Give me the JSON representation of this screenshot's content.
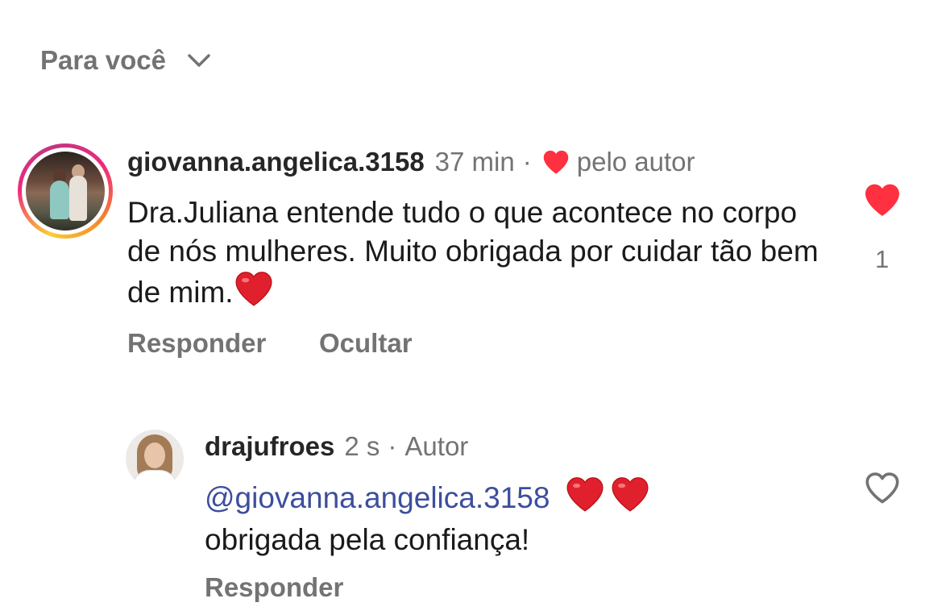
{
  "sort": {
    "label": "Para você"
  },
  "comment1": {
    "username": "giovanna.angelica.3158",
    "time": "37 min",
    "separator": "·",
    "liked_by_author": "pelo autor",
    "text": "Dra.Juliana entende tudo o que acontece no corpo de nós mulheres. Muito obrigada por cuidar tão bem de mim.",
    "reply_label": "Responder",
    "hide_label": "Ocultar",
    "like_count": "1",
    "liked": true
  },
  "comment2": {
    "username": "drajufroes",
    "time": "2 s",
    "separator": "·",
    "author_badge": "Autor",
    "mention": "@giovanna.angelica.3158",
    "text": "obrigada pela confiança!",
    "reply_label": "Responder",
    "liked": false
  },
  "colors": {
    "like_red": "#ff3040",
    "mention_blue": "#3c4e9e",
    "secondary_text": "#737373",
    "primary_text": "#262626"
  }
}
